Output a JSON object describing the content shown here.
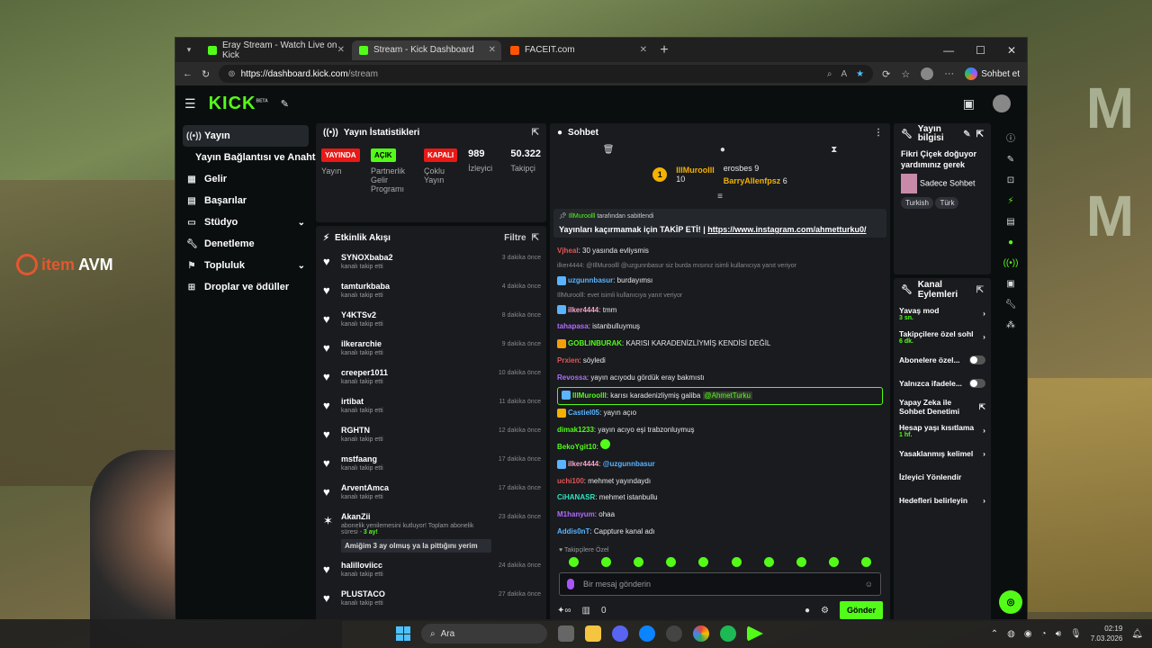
{
  "browser": {
    "tabs": [
      {
        "title": "Eray Stream - Watch Live on Kick",
        "active": false
      },
      {
        "title": "Stream - Kick Dashboard",
        "active": true
      },
      {
        "title": "FACEIT.com",
        "active": false
      }
    ],
    "url_host": "https://dashboard.kick.com",
    "url_path": "/stream",
    "copilot_label": "Sohbet et"
  },
  "overlay": {
    "brand_left": "item",
    "brand_right": "AVM"
  },
  "kick": {
    "logo": "KICK",
    "beta": "BETA"
  },
  "sidebar": {
    "items": [
      {
        "label": "Yayın",
        "icon": "broadcast-icon",
        "active": true
      },
      {
        "label": "Yayın Bağlantısı ve Anahtarı",
        "sub": true
      },
      {
        "label": "Gelir",
        "icon": "wallet-icon"
      },
      {
        "label": "Başarılar",
        "icon": "trophy-icon"
      },
      {
        "label": "Stüdyo",
        "icon": "studio-icon",
        "chevron": true
      },
      {
        "label": "Denetleme",
        "icon": "wrench-icon"
      },
      {
        "label": "Topluluk",
        "icon": "community-icon",
        "chevron": true
      },
      {
        "label": "Droplar ve ödüller",
        "icon": "gift-icon"
      }
    ]
  },
  "stats": {
    "title": "Yayın İstatistikleri",
    "items": [
      {
        "badge": "YAYINDA",
        "label": "Yayın",
        "badge_color": "#e91916"
      },
      {
        "badge": "AÇIK",
        "label": "Partnerlik Gelir Programı",
        "badge_color": "#53fc18"
      },
      {
        "badge": "KAPALI",
        "label": "Çoklu Yayın",
        "badge_color": "#e91916"
      },
      {
        "value": "989",
        "label": "İzleyici"
      },
      {
        "value": "50.322",
        "label": "Takipçi"
      }
    ]
  },
  "activity": {
    "title": "Etkinlik Akışı",
    "filter": "Filtre",
    "items": [
      {
        "name": "SYNOXbaba2",
        "desc": "kanalı takip etti",
        "time": "3 dakika önce"
      },
      {
        "name": "tamturkbaba",
        "desc": "kanalı takip etti",
        "time": "4 dakika önce"
      },
      {
        "name": "Y4KTSv2",
        "desc": "kanalı takip etti",
        "time": "8 dakika önce"
      },
      {
        "name": "ilkerarchie",
        "desc": "kanalı takip etti",
        "time": "9 dakika önce"
      },
      {
        "name": "creeper1011",
        "desc": "kanalı takip etti",
        "time": "10 dakika önce"
      },
      {
        "name": "irtibat",
        "desc": "kanalı takip etti",
        "time": "11 dakika önce"
      },
      {
        "name": "RGHTN",
        "desc": "kanalı takip etti",
        "time": "12 dakika önce"
      },
      {
        "name": "mstfaang",
        "desc": "kanalı takip etti",
        "time": "17 dakika önce"
      },
      {
        "name": "ArventAmca",
        "desc": "kanalı takip etti",
        "time": "17 dakika önce"
      }
    ],
    "sub_item": {
      "name": "AkanZii",
      "desc": "abonelik yenilemesini kutluyor! Toplam abonelik süresi -",
      "months": "3 ay!",
      "note": "Amiğim 3 ay olmuş ya la pittığını yerim",
      "time": "23 dakika önce"
    },
    "tail": [
      {
        "name": "halilloviicc",
        "desc": "kanalı takip etti",
        "time": "24 dakika önce"
      },
      {
        "name": "PLUSTACO",
        "desc": "kanalı takip etti",
        "time": "27 dakika önce"
      }
    ]
  },
  "chat": {
    "title": "Sohbet",
    "leaderboard": [
      {
        "name": "IllMuroolll",
        "count": "10"
      },
      {
        "name": "erosbes",
        "count": "9"
      },
      {
        "name": "BarryAllenfpsz",
        "count": "6"
      }
    ],
    "pinned": {
      "by_user": "IllMuroolll",
      "by_text": "tarafından sabitlendi",
      "text": "Yayınları kaçırmamak için TAKİP ETİ! |",
      "link": "https://www.instagram.com/ahmetturku0/"
    },
    "messages": [
      {
        "user": "Vjheal",
        "color": "#e05858",
        "text": "30 yasında evliysmis"
      },
      {
        "reply": "ilker4444: @IllMuroolll @uzgunnbasur siz burda mısınız isimli kullanıcıya yanıt veriyor"
      },
      {
        "user": "uzgunnbasur",
        "color": "#5ab4ff",
        "text": "burdayımsı"
      },
      {
        "reply": "IllMuroolll: evet isimli kullanıcıya yanıt veriyor"
      },
      {
        "user": "ilker4444",
        "color": "#f5a3c7",
        "text": "tmm"
      },
      {
        "user": "tahapasa",
        "color": "#b26bff",
        "text": "istanbulluymuş"
      },
      {
        "user": "GOBLINBURAK",
        "color": "#53fc18",
        "text": "KARISI KARADENİZLİYMİŞ KENDİSİ DEĞİL"
      },
      {
        "user": "Prxien",
        "color": "#e05858",
        "text": "söyledi"
      },
      {
        "user": "Revossa",
        "color": "#b26bff",
        "text": "yayın acıyodu gördük eray bakmıstı"
      },
      {
        "user": "IllMuroolll",
        "color": "#53fc18",
        "text": "karısı karadenizliymiş galiba",
        "mention": "@AhmetTurku",
        "highlight": true
      },
      {
        "user": "Castiel05",
        "color": "#5ab4ff",
        "text": "yayın açıo"
      },
      {
        "user": "dimak1233",
        "color": "#53fc18",
        "text": "yayın acıyo eşi trabzonluymuş"
      },
      {
        "user": "BekoYgit10",
        "color": "#53fc18",
        "text": ""
      },
      {
        "user": "ilker4444",
        "color": "#f5a3c7",
        "text": "",
        "mention": "@uzgunnbasur"
      },
      {
        "user": "uchi100",
        "color": "#e05858",
        "text": "mehmet yayındaydı"
      },
      {
        "user": "CiHANASR",
        "color": "#2ee6c0",
        "text": "mehmet istanbullu"
      },
      {
        "user": "M1hanyum",
        "color": "#b26bff",
        "text": "ohaa"
      },
      {
        "user": "Addis0nT",
        "color": "#5ab4ff",
        "text": "Cappture kanal adı"
      }
    ],
    "sub_only": "Takipçilere Özel",
    "placeholder": "Bir mesaj gönderin",
    "count": "0",
    "send": "Gönder"
  },
  "stream_info": {
    "title": "Yayın bilgisi",
    "stream_title": "Fikri Çiçek doğuyor yardımınız gerek",
    "category": "Sadece Sohbet",
    "tags": [
      "Turkish",
      "Türk"
    ]
  },
  "channel_actions": {
    "title": "Kanal Eylemleri",
    "items": [
      {
        "label": "Yavaş mod",
        "sub": "3 sn.",
        "type": "arrow"
      },
      {
        "label": "Takipçilere özel sohl",
        "sub": "6 dk.",
        "type": "arrow"
      },
      {
        "label": "Abonelere özel...",
        "type": "toggle"
      },
      {
        "label": "Yalnızca ifadele...",
        "type": "toggle"
      },
      {
        "label": "Yapay Zeka ile Sohbet Denetimi",
        "type": "ext"
      },
      {
        "label": "Hesap yaşı kısıtlama",
        "sub": "1 hf.",
        "type": "arrow"
      },
      {
        "label": "Yasaklanmış kelimel",
        "type": "arrow"
      },
      {
        "label": "İzleyici Yönlendir",
        "type": "none"
      },
      {
        "label": "Hedefleri belirleyin",
        "type": "arrow"
      }
    ]
  },
  "taskbar": {
    "search": "Ara",
    "time": "02:19",
    "date": "7.03.2026"
  }
}
